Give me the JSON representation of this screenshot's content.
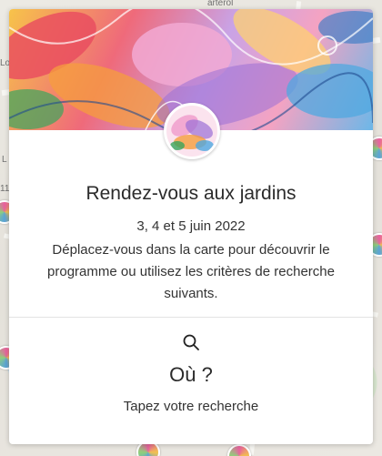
{
  "map": {
    "labels": [
      "arterol",
      "Lo",
      "11",
      "L"
    ]
  },
  "card": {
    "title": "Rendez-vous aux jardins",
    "dates": "3, 4 et 5 juin 2022",
    "description": "Déplacez-vous dans la carte pour découvrir le programme ou utilisez les critères de recherche suivants.",
    "search": {
      "icon": "search-icon",
      "heading": "Où ?",
      "hint": "Tapez votre recherche"
    }
  },
  "colors": {
    "card_background": "#ffffff",
    "text": "#333333",
    "divider": "#e3e3e3"
  }
}
